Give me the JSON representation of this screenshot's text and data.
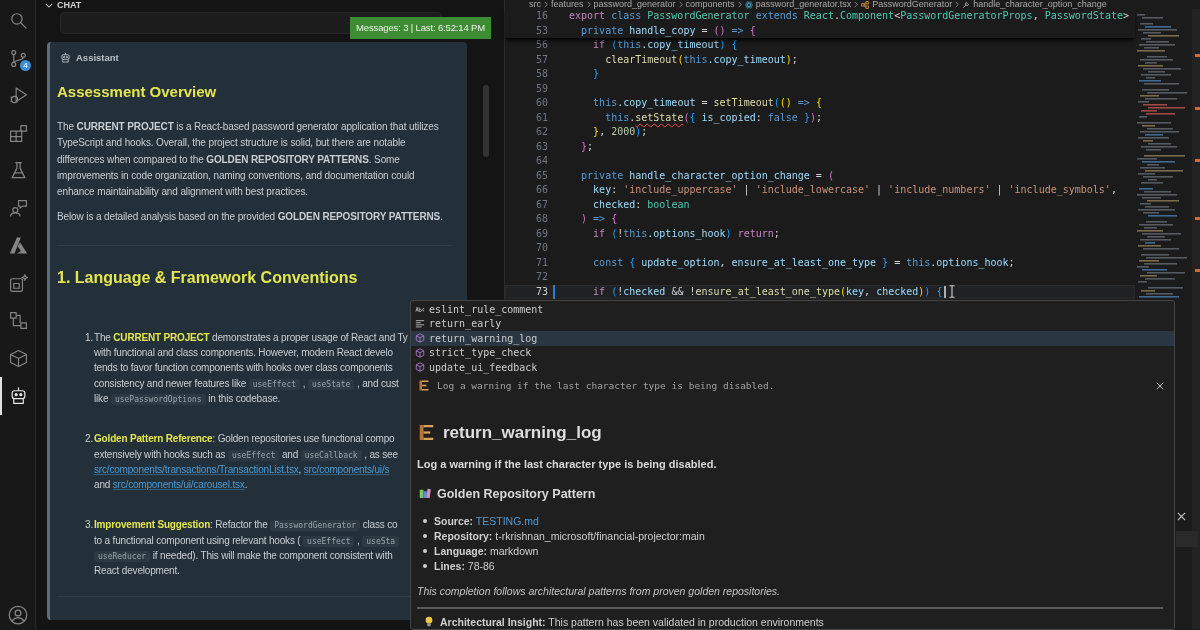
{
  "activity_bar": {
    "items": [
      {
        "kind": "search",
        "selected": false
      },
      {
        "kind": "scm",
        "selected": false,
        "badge": "4"
      },
      {
        "kind": "debug",
        "selected": false
      },
      {
        "kind": "extensions",
        "selected": false
      },
      {
        "kind": "testing",
        "selected": false
      },
      {
        "kind": "share",
        "selected": false
      },
      {
        "kind": "logo",
        "selected": false
      },
      {
        "kind": "generate",
        "selected": false
      },
      {
        "kind": "graph",
        "selected": false
      },
      {
        "kind": "package",
        "selected": false
      },
      {
        "kind": "robot",
        "selected": true
      }
    ]
  },
  "chat": {
    "header": "CHAT",
    "status_badge": "Messages: 3 | Last: 6:52:14 PM",
    "message": {
      "role": "Assistant",
      "heading": "Assessment Overview",
      "paragraphs": [
        "The **CURRENT PROJECT** is a React-based password generator application that utilizes TypeScript and hooks. Overall, the project structure is solid, but there are notable differences when compared to the **GOLDEN REPOSITORY PATTERNS**. Some improvements in code organization, naming conventions, and documentation could enhance maintainability and alignment with best practices.",
        "Below is a detailed analysis based on the provided **GOLDEN REPOSITORY PATTERNS**."
      ],
      "section_heading": "1. Language & Framework Conventions",
      "list": [
        {
          "number": "1.",
          "lines": [
            [
              {
                "text": "The ",
                "kind": "plain"
              },
              {
                "text": "CURRENT PROJECT",
                "kind": "bold"
              },
              {
                "text": " demonstrates a proper usage of React and Ty",
                "kind": "plain"
              }
            ],
            [
              {
                "text": "with functional and class components. However, modern React develo",
                "kind": "plain"
              }
            ],
            [
              {
                "text": "tends to favor function components with hooks over class components",
                "kind": "plain"
              }
            ],
            [
              {
                "text": "consistency and newer features like ",
                "kind": "plain"
              },
              {
                "text": "useEffect",
                "kind": "code"
              },
              {
                "text": " , ",
                "kind": "plain"
              },
              {
                "text": "useState",
                "kind": "code"
              },
              {
                "text": " , and cust",
                "kind": "plain"
              }
            ],
            [
              {
                "text": "like ",
                "kind": "plain"
              },
              {
                "text": "usePasswordOptions",
                "kind": "code"
              },
              {
                "text": " in this codebase.",
                "kind": "plain"
              }
            ]
          ]
        },
        {
          "number": "2.",
          "lines": [
            [
              {
                "text": "Golden Pattern Reference",
                "kind": "bold"
              },
              {
                "text": ": Golden repositories use functional compo",
                "kind": "plain"
              }
            ],
            [
              {
                "text": "extensively with hooks such as ",
                "kind": "plain"
              },
              {
                "text": "useEffect",
                "kind": "code"
              },
              {
                "text": " and ",
                "kind": "plain"
              },
              {
                "text": "useCallback",
                "kind": "code"
              },
              {
                "text": " , as see",
                "kind": "plain"
              }
            ],
            [
              {
                "text": "src/components/transactions/TransactionList.tsx",
                "kind": "link"
              },
              {
                "text": ", ",
                "kind": "plain"
              },
              {
                "text": "src/components/ui/s",
                "kind": "link"
              }
            ],
            [
              {
                "text": "and ",
                "kind": "plain"
              },
              {
                "text": "src/components/ui/carousel.tsx",
                "kind": "link"
              },
              {
                "text": ".",
                "kind": "plain"
              }
            ]
          ]
        },
        {
          "number": "3.",
          "lines": [
            [
              {
                "text": "Improvement Suggestion",
                "kind": "bold"
              },
              {
                "text": ": Refactor the ",
                "kind": "plain"
              },
              {
                "text": "PasswordGenerator",
                "kind": "code"
              },
              {
                "text": " class co",
                "kind": "plain"
              }
            ],
            [
              {
                "text": "to a functional component using relevant hooks ( ",
                "kind": "plain"
              },
              {
                "text": "useEffect",
                "kind": "code"
              },
              {
                "text": " , ",
                "kind": "plain"
              },
              {
                "text": "useSta",
                "kind": "code"
              }
            ],
            [
              {
                "text": "useReducer",
                "kind": "code"
              },
              {
                "text": " if needed). This will make the component consistent with",
                "kind": "plain"
              }
            ],
            [
              {
                "text": "React development.",
                "kind": "plain"
              }
            ]
          ]
        }
      ]
    }
  },
  "editor": {
    "breadcrumbs": [
      {
        "label": "src",
        "kind": "folder"
      },
      {
        "label": "features",
        "kind": "folder"
      },
      {
        "label": "password_generator",
        "kind": "folder"
      },
      {
        "label": "components",
        "kind": "folder"
      },
      {
        "label": "password_generator.tsx",
        "kind": "file"
      },
      {
        "label": "PasswordGenerator",
        "kind": "class"
      },
      {
        "label": "handle_character_option_change",
        "kind": "method"
      }
    ],
    "sticky_lines": [
      {
        "number": "16",
        "tokens": [
          {
            "text": "export",
            "kind": "control"
          },
          {
            "text": " class",
            "kind": "keyword"
          },
          {
            "text": " PasswordGenerator",
            "kind": "type"
          },
          {
            "text": " extends",
            "kind": "keyword"
          },
          {
            "text": " React",
            "kind": "type"
          },
          {
            "text": ".",
            "kind": "plain"
          },
          {
            "text": "Component",
            "kind": "type"
          },
          {
            "text": "<",
            "kind": "plain"
          },
          {
            "text": "PasswordGeneratorProps",
            "kind": "type"
          },
          {
            "text": ", ",
            "kind": "plain"
          },
          {
            "text": "PasswordState",
            "kind": "type"
          },
          {
            "text": ">",
            "kind": "plain"
          }
        ]
      },
      {
        "number": "53",
        "tokens": [
          {
            "text": "  private",
            "kind": "keyword"
          },
          {
            "text": " handle_copy",
            "kind": "variable"
          },
          {
            "text": " = ",
            "kind": "plain"
          },
          {
            "text": "()",
            "kind": "bracket2"
          },
          {
            "text": " =>",
            "kind": "keyword"
          },
          {
            "text": " {",
            "kind": "bracket2"
          }
        ]
      }
    ],
    "lines": [
      {
        "number": "56",
        "current": false,
        "modified": false,
        "tokens": [
          {
            "text": "    if",
            "kind": "control"
          },
          {
            "text": " (",
            "kind": "bracket3"
          },
          {
            "text": "this",
            "kind": "keyword"
          },
          {
            "text": ".copy_timeout",
            "kind": "variable"
          },
          {
            "text": ")",
            "kind": "bracket3"
          },
          {
            "text": " {",
            "kind": "bracket3"
          }
        ]
      },
      {
        "number": "57",
        "current": false,
        "modified": false,
        "tokens": [
          {
            "text": "      clearTimeout",
            "kind": "function"
          },
          {
            "text": "(",
            "kind": "bracket1"
          },
          {
            "text": "this",
            "kind": "keyword"
          },
          {
            "text": ".copy_timeout",
            "kind": "variable"
          },
          {
            "text": ")",
            "kind": "bracket1"
          },
          {
            "text": ";",
            "kind": "plain"
          }
        ]
      },
      {
        "number": "58",
        "current": false,
        "modified": false,
        "tokens": [
          {
            "text": "    }",
            "kind": "bracket3"
          }
        ]
      },
      {
        "number": "59",
        "current": false,
        "modified": false
      },
      {
        "number": "60",
        "current": false,
        "modified": false,
        "tokens": [
          {
            "text": "    this",
            "kind": "keyword"
          },
          {
            "text": ".copy_timeout",
            "kind": "variable"
          },
          {
            "text": " = ",
            "kind": "plain"
          },
          {
            "text": "setTimeout",
            "kind": "function"
          },
          {
            "text": "(",
            "kind": "bracket3"
          },
          {
            "text": "()",
            "kind": "bracket1"
          },
          {
            "text": " =>",
            "kind": "keyword"
          },
          {
            "text": " {",
            "kind": "bracket1"
          }
        ]
      },
      {
        "number": "61",
        "current": false,
        "modified": false,
        "tokens": [
          {
            "text": "      this",
            "kind": "keyword"
          },
          {
            "text": ".",
            "kind": "plain"
          },
          {
            "text": "setState",
            "kind": "error"
          },
          {
            "text": "(",
            "kind": "bracket2"
          },
          {
            "text": "{",
            "kind": "bracket3"
          },
          {
            "text": " is_copied",
            "kind": "variable"
          },
          {
            "text": ": ",
            "kind": "plain"
          },
          {
            "text": "false",
            "kind": "keyword"
          },
          {
            "text": " }",
            "kind": "bracket3"
          },
          {
            "text": ")",
            "kind": "bracket2"
          },
          {
            "text": ";",
            "kind": "plain"
          }
        ]
      },
      {
        "number": "62",
        "current": false,
        "modified": false,
        "tokens": [
          {
            "text": "    }",
            "kind": "bracket1"
          },
          {
            "text": ", ",
            "kind": "plain"
          },
          {
            "text": "2000",
            "kind": "number"
          },
          {
            "text": ")",
            "kind": "bracket3"
          },
          {
            "text": ";",
            "kind": "plain"
          }
        ]
      },
      {
        "number": "63",
        "current": false,
        "modified": false,
        "tokens": [
          {
            "text": "  }",
            "kind": "bracket2"
          },
          {
            "text": ";",
            "kind": "plain"
          }
        ]
      },
      {
        "number": "64",
        "current": false,
        "modified": false
      },
      {
        "number": "65",
        "current": false,
        "modified": false,
        "tokens": [
          {
            "text": "  private",
            "kind": "keyword"
          },
          {
            "text": " handle_character_option_change",
            "kind": "variable"
          },
          {
            "text": " = ",
            "kind": "plain"
          },
          {
            "text": "(",
            "kind": "bracket2"
          }
        ]
      },
      {
        "number": "66",
        "current": false,
        "modified": false,
        "tokens": [
          {
            "text": "    key",
            "kind": "variable"
          },
          {
            "text": ": ",
            "kind": "plain"
          },
          {
            "text": "'include_uppercase'",
            "kind": "string"
          },
          {
            "text": " | ",
            "kind": "plain"
          },
          {
            "text": "'include_lowercase'",
            "kind": "string"
          },
          {
            "text": " | ",
            "kind": "plain"
          },
          {
            "text": "'include_numbers'",
            "kind": "string"
          },
          {
            "text": " | ",
            "kind": "plain"
          },
          {
            "text": "'include_symbols'",
            "kind": "string"
          },
          {
            "text": ",",
            "kind": "plain"
          }
        ]
      },
      {
        "number": "67",
        "current": false,
        "modified": false,
        "tokens": [
          {
            "text": "    checked",
            "kind": "variable"
          },
          {
            "text": ": ",
            "kind": "plain"
          },
          {
            "text": "boolean",
            "kind": "type"
          }
        ]
      },
      {
        "number": "68",
        "current": false,
        "modified": false,
        "tokens": [
          {
            "text": "  )",
            "kind": "bracket2"
          },
          {
            "text": " =>",
            "kind": "keyword"
          },
          {
            "text": " {",
            "kind": "bracket2"
          }
        ]
      },
      {
        "number": "69",
        "current": false,
        "modified": false,
        "tokens": [
          {
            "text": "    if",
            "kind": "control"
          },
          {
            "text": " (",
            "kind": "bracket3"
          },
          {
            "text": "!",
            "kind": "plain"
          },
          {
            "text": "this",
            "kind": "keyword"
          },
          {
            "text": ".options_hook",
            "kind": "variable"
          },
          {
            "text": ")",
            "kind": "bracket3"
          },
          {
            "text": " return",
            "kind": "control"
          },
          {
            "text": ";",
            "kind": "plain"
          }
        ]
      },
      {
        "number": "70",
        "current": false,
        "modified": false
      },
      {
        "number": "71",
        "current": false,
        "modified": false,
        "tokens": [
          {
            "text": "    const",
            "kind": "keyword"
          },
          {
            "text": " {",
            "kind": "bracket3"
          },
          {
            "text": " update_option",
            "kind": "variable"
          },
          {
            "text": ", ",
            "kind": "plain"
          },
          {
            "text": "ensure_at_least_one_type",
            "kind": "variable"
          },
          {
            "text": " }",
            "kind": "bracket3"
          },
          {
            "text": " = ",
            "kind": "plain"
          },
          {
            "text": "this",
            "kind": "keyword"
          },
          {
            "text": ".options_hook",
            "kind": "variable"
          },
          {
            "text": ";",
            "kind": "plain"
          }
        ]
      },
      {
        "number": "72",
        "current": false,
        "modified": false
      },
      {
        "number": "73",
        "current": true,
        "modified": true,
        "tokens": [
          {
            "text": "    if",
            "kind": "control"
          },
          {
            "text": " (",
            "kind": "bracket3"
          },
          {
            "text": "!",
            "kind": "plain"
          },
          {
            "text": "checked",
            "kind": "variable"
          },
          {
            "text": " && ",
            "kind": "plain"
          },
          {
            "text": "!",
            "kind": "plain"
          },
          {
            "text": "ensure_at_least_one_type",
            "kind": "function"
          },
          {
            "text": "(",
            "kind": "bracket1"
          },
          {
            "text": "key",
            "kind": "variable"
          },
          {
            "text": ", ",
            "kind": "plain"
          },
          {
            "text": "checked",
            "kind": "variable"
          },
          {
            "text": ")",
            "kind": "bracket1"
          },
          {
            "text": ")",
            "kind": "bracket3"
          },
          {
            "text": " {",
            "kind": "bracket3"
          }
        ]
      }
    ]
  },
  "suggestions": {
    "items": [
      {
        "label": "eslint_rule_comment",
        "kind": "text",
        "selected": false
      },
      {
        "label": "return_early",
        "kind": "snippet",
        "selected": false
      },
      {
        "label": "return_warning_log",
        "kind": "module",
        "selected": true
      },
      {
        "label": "strict_type_check",
        "kind": "module",
        "selected": false
      },
      {
        "label": "update_ui_feedback",
        "kind": "module",
        "selected": false
      }
    ],
    "details": {
      "summary": "Log a warning if the last character type is being disabled.",
      "title": "return_warning_log",
      "description": "Log a warning if the last character type is being disabled.",
      "section_title": "Golden Repository Pattern",
      "facts": [
        {
          "label": "Source:",
          "value": "TESTING.md",
          "kind": "link"
        },
        {
          "label": "Repository:",
          "value": "t-rkrishnan_microsoft/financial-projector:main",
          "kind": "text"
        },
        {
          "label": "Language:",
          "value": "markdown",
          "kind": "text"
        },
        {
          "label": "Lines:",
          "value": "78-86",
          "kind": "text"
        }
      ],
      "note": "This completion follows architectural patterns from proven golden repositories.",
      "insight": "**Architectural Insight:** This pattern has been validated in production environments"
    }
  }
}
